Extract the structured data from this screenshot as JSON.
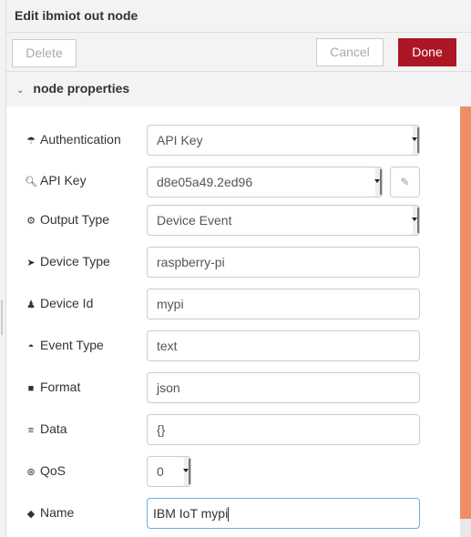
{
  "header": {
    "title": "Edit ibmiot out node"
  },
  "toolbar": {
    "delete_label": "Delete",
    "cancel_label": "Cancel",
    "done_label": "Done"
  },
  "section": {
    "title": "node properties"
  },
  "fields": {
    "authentication": {
      "label": "Authentication",
      "value": "API Key",
      "icon": "umbrella-icon"
    },
    "api_key": {
      "label": "API Key",
      "value": "d8e05a49.2ed96",
      "icon": "key-icon"
    },
    "output_type": {
      "label": "Output Type",
      "value": "Device Event",
      "icon": "cogs-icon"
    },
    "device_type": {
      "label": "Device Type",
      "value": "raspberry-pi",
      "icon": "rocket-icon"
    },
    "device_id": {
      "label": "Device Id",
      "value": "mypi",
      "icon": "user-icon"
    },
    "event_type": {
      "label": "Event Type",
      "value": "text",
      "icon": "dashboard-icon"
    },
    "format": {
      "label": "Format",
      "value": "json",
      "icon": "file-icon"
    },
    "data": {
      "label": "Data",
      "value": "{}",
      "icon": "database-icon"
    },
    "qos": {
      "label": "QoS",
      "value": "0",
      "icon": "empire-icon"
    },
    "name": {
      "label": "Name",
      "value": "IBM IoT mypi",
      "icon": "tag-icon"
    }
  },
  "colors": {
    "done": "#ad1625",
    "scrollbar": "#ee8e68",
    "focus": "#66afe9"
  }
}
